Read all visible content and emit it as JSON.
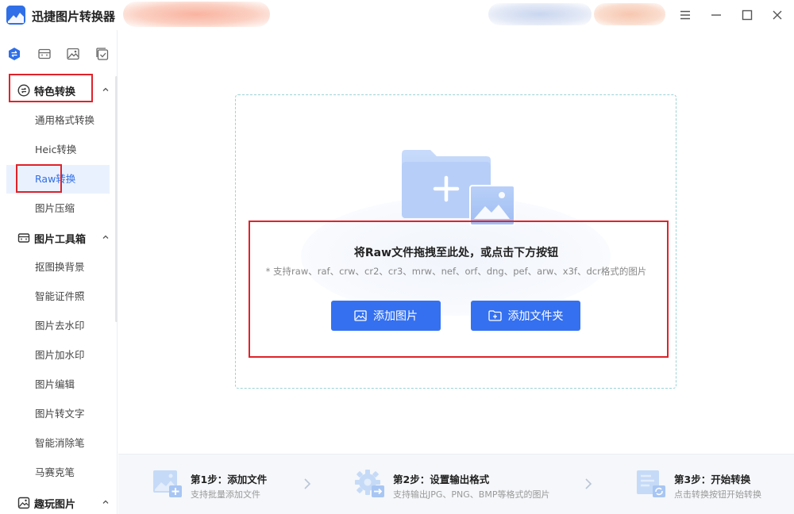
{
  "app": {
    "title": "迅捷图片转换器",
    "brand_color": "#2f6fe8",
    "window_controls": [
      "menu-icon",
      "minimize-icon",
      "maximize-icon",
      "close-icon"
    ]
  },
  "sidebar": {
    "tabs": [
      {
        "icon": "convert-icon",
        "active": true
      },
      {
        "icon": "toolbox-icon",
        "active": false
      },
      {
        "icon": "image-icon",
        "active": false
      },
      {
        "icon": "check-icon",
        "active": false
      }
    ],
    "sections": [
      {
        "label": "特色转换",
        "icon": "convert-circle-icon",
        "expanded": true,
        "items": [
          "通用格式转换",
          "Heic转换",
          "Raw转换",
          "图片压缩"
        ]
      },
      {
        "label": "图片工具箱",
        "icon": "toolbox-icon",
        "expanded": true,
        "items": [
          "抠图换背景",
          "智能证件照",
          "图片去水印",
          "图片加水印",
          "图片编辑",
          "图片转文字",
          "智能消除笔",
          "马赛克笔"
        ]
      },
      {
        "label": "趣玩图片",
        "icon": "fun-icon",
        "expanded": true,
        "items": []
      }
    ],
    "active_item": "Raw转换"
  },
  "dropzone": {
    "title": "将Raw文件拖拽至此处，或点击下方按钮",
    "subtitle": "* 支持raw、raf、crw、cr2、cr3、mrw、nef、orf、dng、pef、arw、x3f、dcr格式的图片",
    "add_image_label": "添加图片",
    "add_folder_label": "添加文件夹"
  },
  "steps": [
    {
      "title": "第1步：添加文件",
      "desc": "支持批量添加文件"
    },
    {
      "title": "第2步：设置输出格式",
      "desc": "支持输出JPG、PNG、BMP等格式的图片"
    },
    {
      "title": "第3步：开始转换",
      "desc": "点击转换按钮开始转换"
    }
  ]
}
